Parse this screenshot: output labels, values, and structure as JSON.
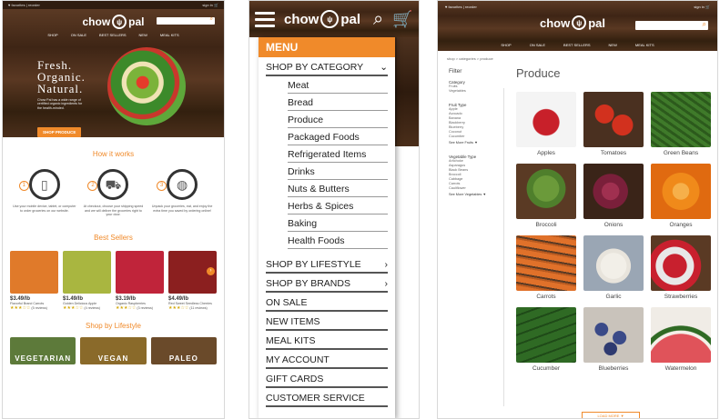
{
  "brand": "chow pal",
  "utility": {
    "favorites": "favorites",
    "reorder": "reorder",
    "signin": "sign in"
  },
  "nav": [
    "SHOP",
    "ON SALE",
    "BEST SELLERS",
    "NEW",
    "MEAL KITS"
  ],
  "home": {
    "headline": [
      "Fresh.",
      "Organic.",
      "Natural."
    ],
    "subtext": "Chow Pal has a wide range of certified organic ingredients for the health-minded.",
    "cta": "SHOP PRODUCE",
    "how_title": "How it works",
    "steps": [
      {
        "n": "1",
        "icon": "phone-icon",
        "text": "Use your mobile device, tablet, or computer to order groceries on our website."
      },
      {
        "n": "2",
        "icon": "truck-icon",
        "text": "At checkout, choose your shipping speed and we will deliver the groceries right to your door."
      },
      {
        "n": "3",
        "icon": "plate-icon",
        "text": "Unpack your groceries, eat, and enjoy the extra time you saved by ordering online!"
      }
    ],
    "best_title": "Best Sellers",
    "best": [
      {
        "price": "$3.49/lb",
        "name": "Flavorful Brand Carrots",
        "stars": "★★★☆☆",
        "reviews": "(5 reviews)",
        "color": "#e07a2a"
      },
      {
        "price": "$1.49/lb",
        "name": "Golden Delicious Apple",
        "stars": "★★★☆☆",
        "reviews": "(4 reviews)",
        "color": "#a9b640"
      },
      {
        "price": "$3.19/lb",
        "name": "Organic Raspberries",
        "stars": "★★★☆☆",
        "reviews": "(3 reviews)",
        "color": "#c0243a"
      },
      {
        "price": "$4.49/lb",
        "name": "Red Sweet Seedless Cherries",
        "stars": "★★★☆☆",
        "reviews": "(11 reviews)",
        "color": "#8b1f1f"
      }
    ],
    "lifestyle_title": "Shop by Lifestyle",
    "lifestyles": [
      "VEGETARIAN",
      "VEGAN",
      "PALEO"
    ]
  },
  "menu": {
    "header": "MENU",
    "shop_by_category": "SHOP BY CATEGORY",
    "categories": [
      "Meat",
      "Bread",
      "Produce",
      "Packaged Foods",
      "Refrigerated Items",
      "Drinks",
      "Nuts & Butters",
      "Herbs & Spices",
      "Baking",
      "Health Foods"
    ],
    "lifestyle": "SHOP BY LIFESTYLE",
    "brands": "SHOP BY BRANDS",
    "items": [
      "ON SALE",
      "NEW ITEMS",
      "MEAL KITS",
      "MY ACCOUNT",
      "GIFT CARDS",
      "CUSTOMER SERVICE"
    ]
  },
  "produce": {
    "breadcrumb": "shop > categories > produce",
    "title": "Produce",
    "filter": {
      "title": "Filter",
      "category_label": "Category",
      "categories": [
        "Fruits",
        "Vegetables"
      ],
      "fruit_label": "Fruit Type",
      "fruits": [
        "Apple",
        "Avocado",
        "Banana",
        "Blackberry",
        "Blueberry",
        "Coconut",
        "Cucumber"
      ],
      "see_more_fruits": "See More Fruits",
      "veg_label": "Vegetable Type",
      "vegetables": [
        "Artichoke",
        "Asparagus",
        "Black Beans",
        "Broccoli",
        "Cabbage",
        "Carrots",
        "Cauliflower"
      ],
      "see_more_veg": "See More Vegetables"
    },
    "items": [
      {
        "name": "Apples",
        "color": "#c8202a"
      },
      {
        "name": "Tomatoes",
        "color": "#d2311e"
      },
      {
        "name": "Green Beans",
        "color": "#3f7a2a"
      },
      {
        "name": "Broccoli",
        "color": "#4f7f2c"
      },
      {
        "name": "Onions",
        "color": "#7a1f3a"
      },
      {
        "name": "Oranges",
        "color": "#f08a1a"
      },
      {
        "name": "Carrots",
        "color": "#e0712a"
      },
      {
        "name": "Garlic",
        "color": "#e8e4dc"
      },
      {
        "name": "Strawberries",
        "color": "#c8202e"
      },
      {
        "name": "Cucumber",
        "color": "#2f6a24"
      },
      {
        "name": "Blueberries",
        "color": "#3a4a88"
      },
      {
        "name": "Watermelon",
        "color": "#e0535a"
      }
    ],
    "load_more": "LOAD MORE"
  },
  "colors": {
    "accent": "#f08a2a"
  }
}
